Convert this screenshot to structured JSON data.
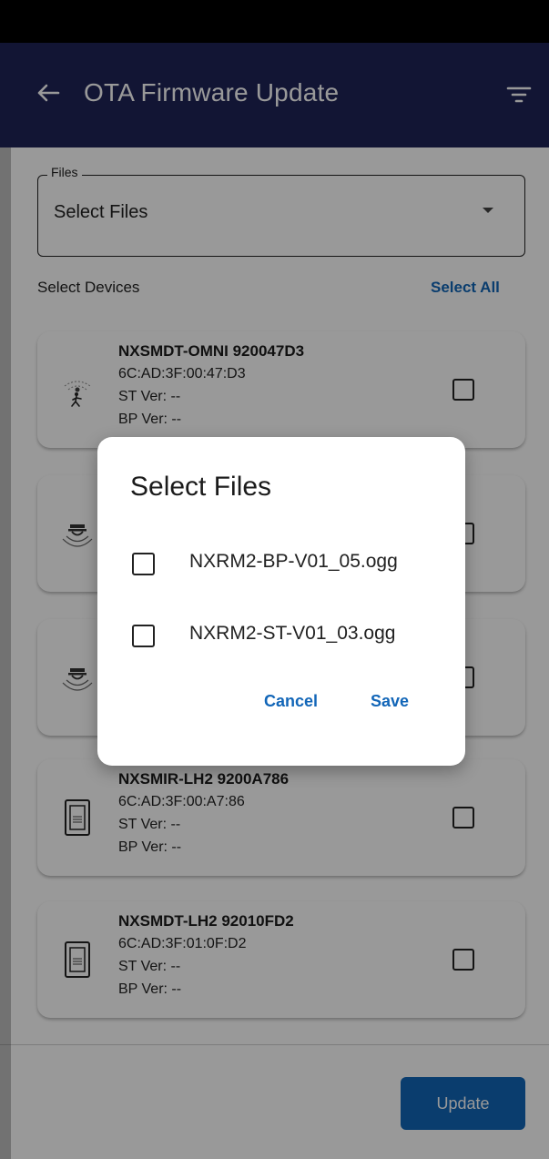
{
  "app_bar": {
    "title": "OTA Firmware Update"
  },
  "files": {
    "legend": "Files",
    "value": "Select Files"
  },
  "devices_header": {
    "label": "Select Devices",
    "select_all": "Select All"
  },
  "devices": [
    {
      "name": "NXSMDT-OMNI 920047D3",
      "mac": "6C:AD:3F:00:47:D3",
      "st": "ST Ver: --",
      "bp": "BP Ver: --",
      "icon": "occupancy-sensor-icon"
    },
    {
      "name": "",
      "mac": "",
      "st": "",
      "bp": "",
      "icon": "ceiling-sensor-icon"
    },
    {
      "name": "",
      "mac": "",
      "st": "",
      "bp": "",
      "icon": "ceiling-sensor-icon"
    },
    {
      "name": "NXSMIR-LH2 9200A786",
      "mac": "6C:AD:3F:00:A7:86",
      "st": "ST Ver: --",
      "bp": "BP Ver: --",
      "icon": "wall-switch-icon"
    },
    {
      "name": "NXSMDT-LH2 92010FD2",
      "mac": "6C:AD:3F:01:0F:D2",
      "st": "ST Ver: --",
      "bp": "BP Ver: --",
      "icon": "wall-switch-icon"
    }
  ],
  "footer": {
    "update_label": "Update"
  },
  "dialog": {
    "title": "Select Files",
    "options": [
      "NXRM2-BP-V01_05.ogg",
      "NXRM2-ST-V01_03.ogg"
    ],
    "cancel_label": "Cancel",
    "save_label": "Save"
  },
  "colors": {
    "app_bar": "#1f2358",
    "accent": "#1266b8",
    "status_bar": "#000000"
  }
}
